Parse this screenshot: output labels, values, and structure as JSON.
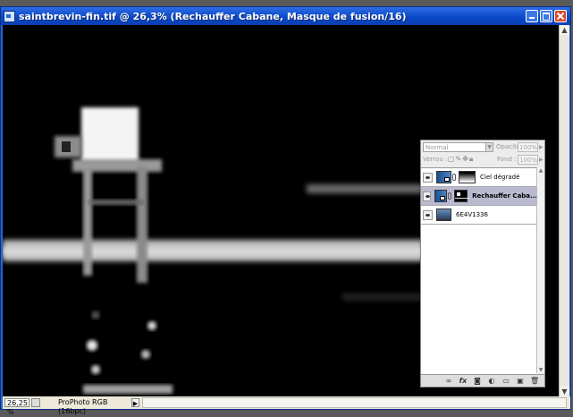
{
  "window": {
    "title": "saintbrevin-fin.tif @ 26,3% (Rechauffer Cabane, Masque de fusion/16)"
  },
  "status": {
    "zoom": "26,25 %",
    "doc_info": "ProPhoto RGB (16bpc)"
  },
  "layers_panel": {
    "blend_mode": "Normal",
    "opacity_label": "Opacité :",
    "opacity_value": "100%",
    "lock_label": "Verrou :",
    "fill_label": "Fond :",
    "fill_value": "100%",
    "layers": [
      {
        "name": "Ciel dégradé",
        "selected": false
      },
      {
        "name": "Rechauffer Caba...",
        "selected": true
      },
      {
        "name": "6E4V1336",
        "selected": false
      }
    ]
  },
  "colors": {
    "titlebar": "#0b49c8",
    "selected_layer": "#b9b9d0",
    "canvas": "#000000"
  }
}
